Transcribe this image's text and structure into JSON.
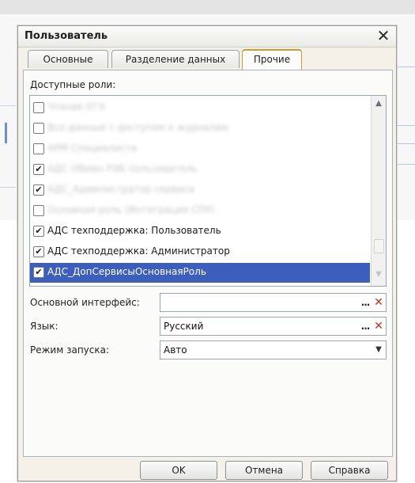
{
  "dialog": {
    "title": "Пользователь",
    "close_symbol": "✕"
  },
  "tabs": [
    {
      "label": "Основные",
      "active": false
    },
    {
      "label": "Разделение данных",
      "active": false
    },
    {
      "label": "Прочие",
      "active": true
    }
  ],
  "roles": {
    "label": "Доступные роли:",
    "items": [
      {
        "label": "Чтение ЕГЭ",
        "checked": false,
        "obscured": true,
        "selected": false
      },
      {
        "label": "Все данные с доступом к журналам",
        "checked": false,
        "obscured": true,
        "selected": false
      },
      {
        "label": "АРМ Специалиста",
        "checked": false,
        "obscured": true,
        "selected": false
      },
      {
        "label": "АДС Обмен РЭБ пользователь",
        "checked": true,
        "obscured": true,
        "selected": false
      },
      {
        "label": "АДС_Администратор сервиса",
        "checked": true,
        "obscured": true,
        "selected": false
      },
      {
        "label": "Основная роль (Интеграция СПУ)",
        "checked": false,
        "obscured": true,
        "selected": false
      },
      {
        "label": "АДС техподдержка: Пользователь",
        "checked": true,
        "obscured": false,
        "selected": false
      },
      {
        "label": "АДС техподдержка: Администратор",
        "checked": true,
        "obscured": false,
        "selected": false
      },
      {
        "label": "АДС_ДопСервисыОсновнаяРоль",
        "checked": true,
        "obscured": false,
        "selected": true
      }
    ],
    "check_mark": "✔"
  },
  "fields": {
    "main_interface": {
      "label": "Основной интерфейс:",
      "value": ""
    },
    "language": {
      "label": "Язык:",
      "value": "Русский"
    },
    "launch_mode": {
      "label": "Режим запуска:",
      "value": "Авто"
    },
    "select_button": "...",
    "clear_button": "✕",
    "dropdown_button": "▼"
  },
  "buttons": {
    "ok": "OK",
    "cancel": "Отмена",
    "help": "Справка"
  },
  "colors": {
    "selection": "#3d5fbb",
    "active_tab_border": "#c89a38",
    "clear_icon": "#c42a1a"
  },
  "icons": {
    "scroll_up": "▲",
    "scroll_down": "▼"
  }
}
